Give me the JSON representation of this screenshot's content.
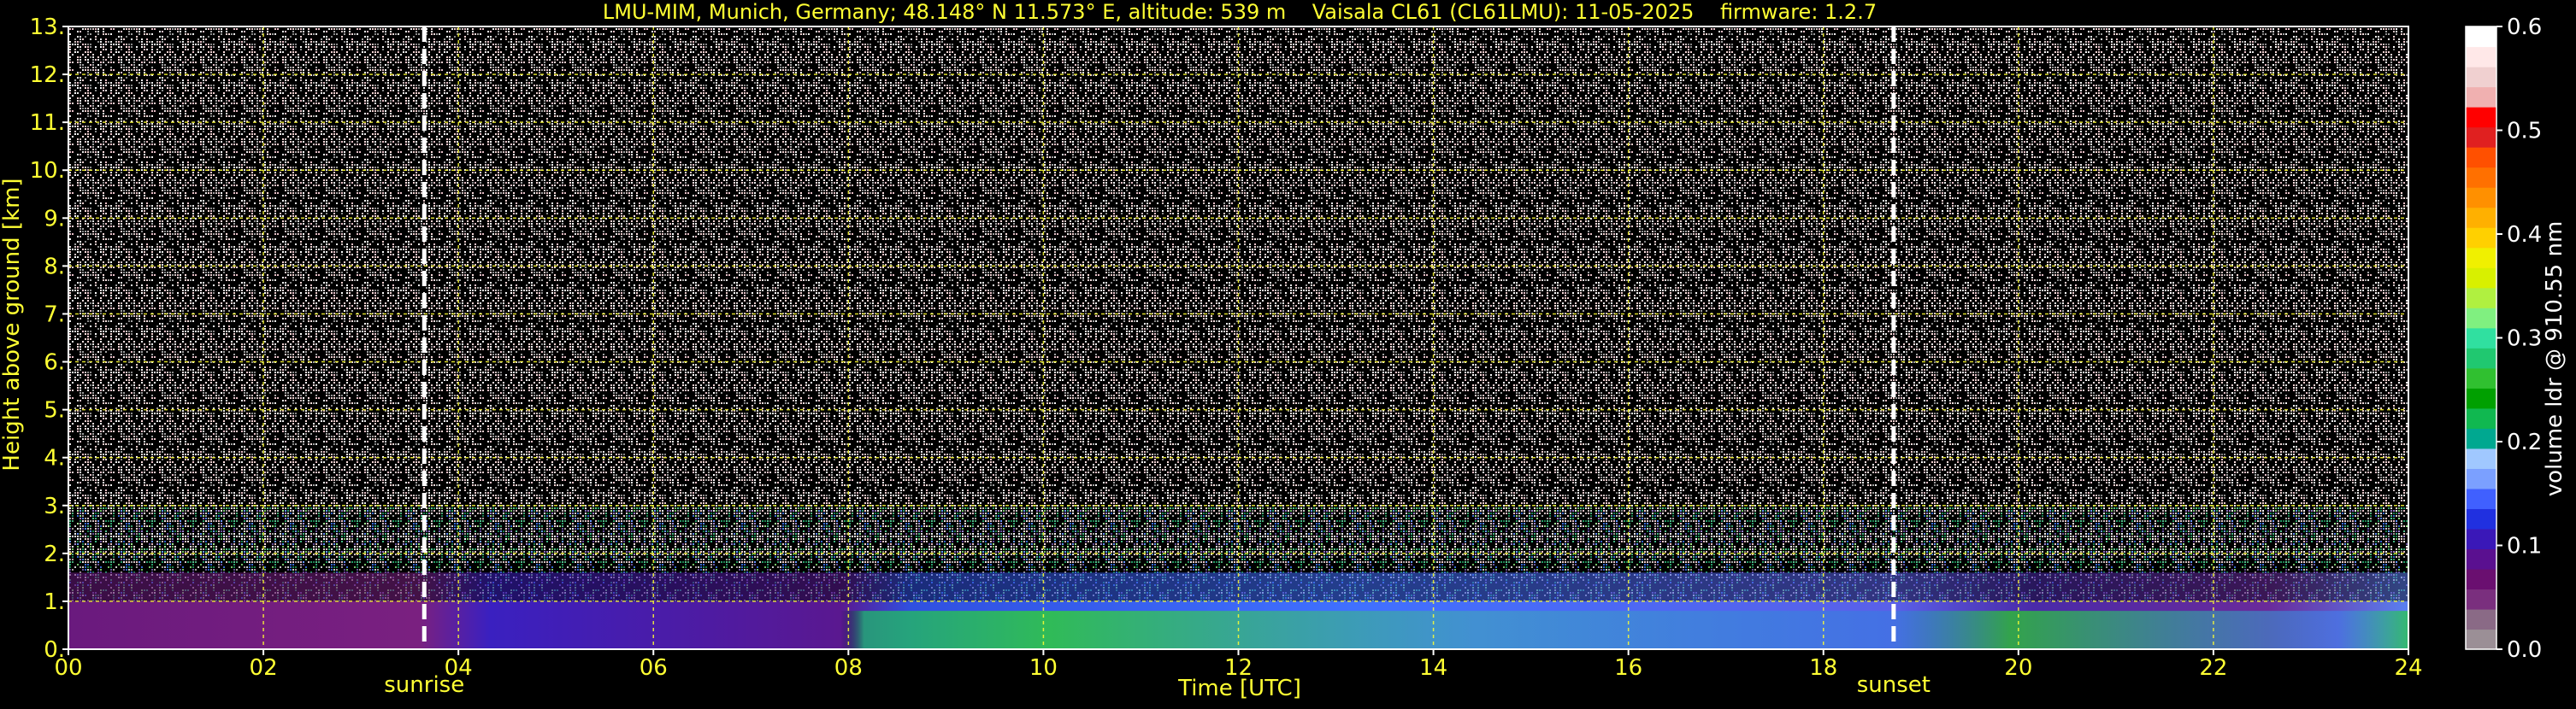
{
  "colors": {
    "background": "#000000",
    "label": "#ffff33",
    "grid": "#ffff33",
    "frame": "#ffffff",
    "marker": "#ffffff"
  },
  "chart_data": {
    "type": "heatmap",
    "title": "LMU-MIM, Munich, Germany; 48.148° N 11.573° E, altitude: 539 m    Vaisala CL61 (CL61LMU): 11-05-2025    firmware: 1.2.7",
    "xlabel": "Time [UTC]",
    "ylabel": "Height above ground [km]",
    "xlim": [
      0,
      24
    ],
    "ylim": [
      0,
      13
    ],
    "x_ticks": [
      0,
      2,
      4,
      6,
      8,
      10,
      12,
      14,
      16,
      18,
      20,
      22,
      24
    ],
    "x_tick_labels": [
      "00",
      "02",
      "04",
      "06",
      "08",
      "10",
      "12",
      "14",
      "16",
      "18",
      "20",
      "22",
      "24"
    ],
    "y_ticks": [
      0,
      1,
      2,
      3,
      4,
      5,
      6,
      7,
      8,
      9,
      10,
      11,
      12,
      13
    ],
    "y_tick_labels": [
      "0.",
      "1.",
      "2.",
      "3.",
      "4.",
      "5.",
      "6.",
      "7.",
      "8.",
      "9.",
      "10.",
      "11.",
      "12.",
      "13."
    ],
    "grid": true,
    "markers": [
      {
        "label": "sunrise",
        "x": 3.65
      },
      {
        "label": "sunset",
        "x": 18.72
      }
    ],
    "colorbar": {
      "label": "volume ldr @ 910.55 nm",
      "range": [
        0,
        0.6
      ],
      "ticks": [
        0.0,
        0.1,
        0.2,
        0.3,
        0.4,
        0.5,
        0.6
      ],
      "tick_labels": [
        "0.0",
        "0.1",
        "0.2",
        "0.3",
        "0.4",
        "0.5",
        "0.6"
      ],
      "colors": [
        "#9b8f96",
        "#8a6a86",
        "#7a2f7e",
        "#6a0f70",
        "#5a1090",
        "#3a18b8",
        "#2030e0",
        "#4060ff",
        "#7ba0ff",
        "#a0c8ff",
        "#00a890",
        "#10b850",
        "#00a000",
        "#30c030",
        "#20c870",
        "#30e0a0",
        "#80f080",
        "#b0f040",
        "#d8f000",
        "#f0f000",
        "#ffd000",
        "#ffb000",
        "#ff9000",
        "#ff7000",
        "#ff5000",
        "#e02020",
        "#ff0000",
        "#f0b0b0",
        "#f0d0d0",
        "#ffe8e8",
        "#ffffff"
      ]
    }
  }
}
